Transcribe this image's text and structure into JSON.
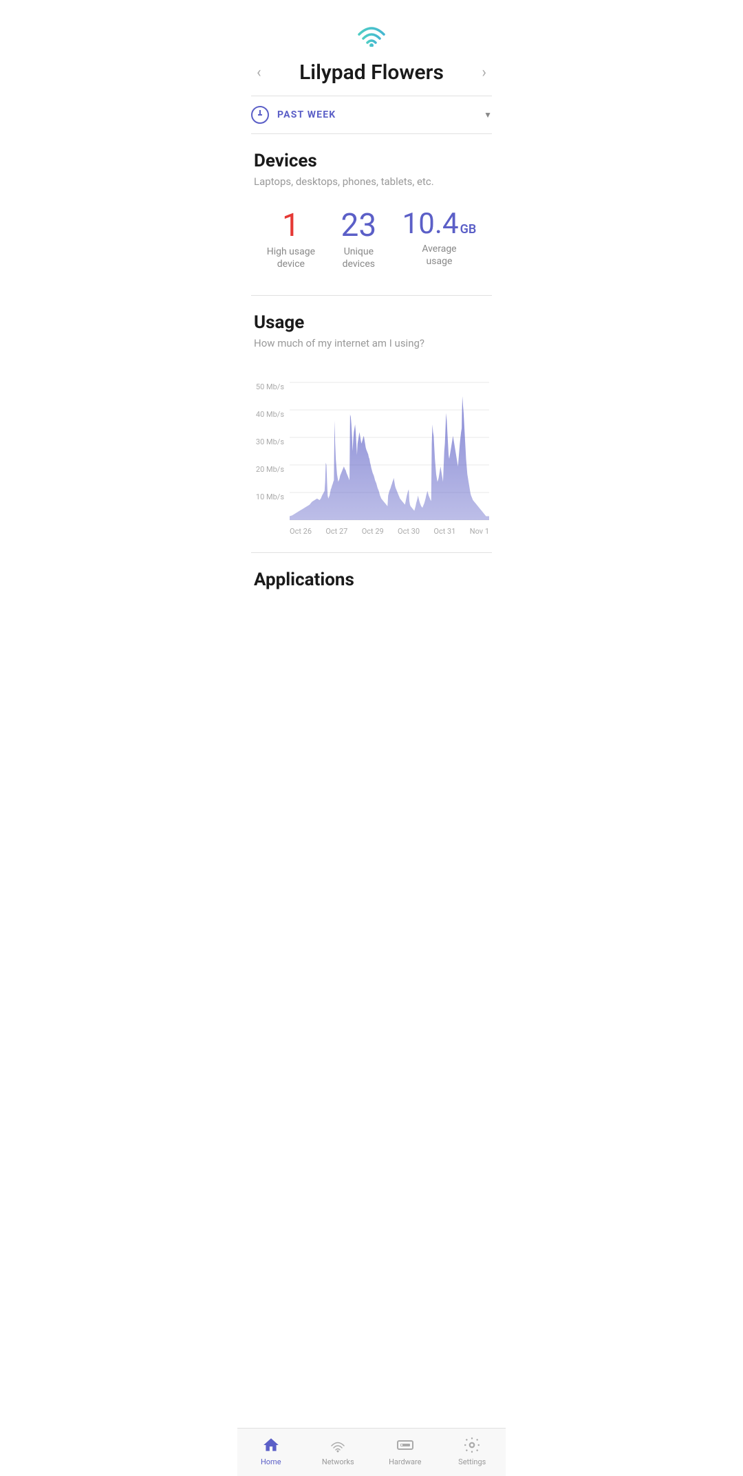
{
  "header": {
    "wifi_icon": "wifi",
    "network_name": "Lilypad Flowers",
    "prev_arrow": "‹",
    "next_arrow": "›"
  },
  "time_selector": {
    "label": "PAST WEEK",
    "icon": "clock"
  },
  "devices": {
    "section_title": "Devices",
    "section_subtitle": "Laptops, desktops, phones, tablets, etc.",
    "stats": [
      {
        "value": "1",
        "label": "High usage\ndevice",
        "color": "red"
      },
      {
        "value": "23",
        "label": "Unique\ndevices",
        "color": "blue"
      },
      {
        "value": "10.4",
        "unit": "GB",
        "label": "Average\nusage",
        "color": "blue"
      }
    ]
  },
  "usage": {
    "section_title": "Usage",
    "section_subtitle": "How much of my internet am I using?",
    "y_labels": [
      "50 Mb/s",
      "40 Mb/s",
      "30 Mb/s",
      "20 Mb/s",
      "10 Mb/s"
    ],
    "x_labels": [
      "Oct 26",
      "Oct 27",
      "Oct 29",
      "Oct 30",
      "Oct 31",
      "Nov 1"
    ],
    "chart_color": "#6366c8"
  },
  "applications": {
    "section_title": "Applications"
  },
  "bottom_nav": {
    "items": [
      {
        "id": "home",
        "label": "Home",
        "active": true
      },
      {
        "id": "networks",
        "label": "Networks",
        "active": false
      },
      {
        "id": "hardware",
        "label": "Hardware",
        "active": false
      },
      {
        "id": "settings",
        "label": "Settings",
        "active": false
      }
    ]
  }
}
